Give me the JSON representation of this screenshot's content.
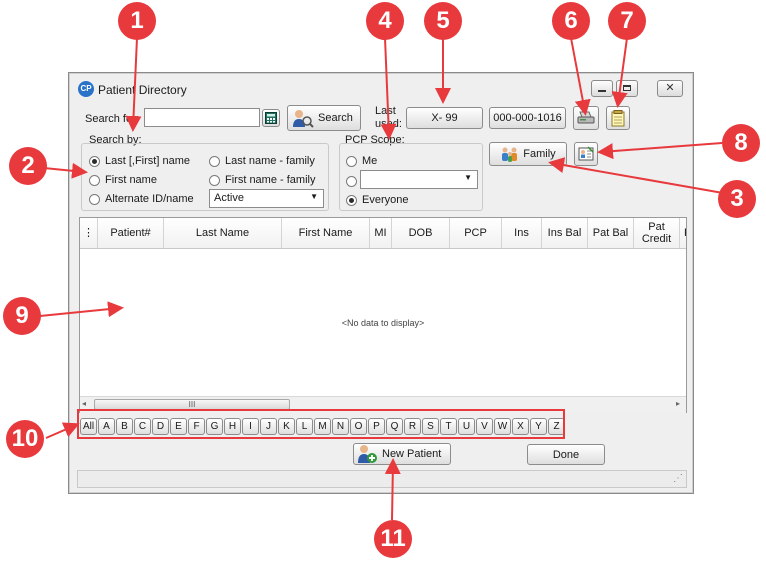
{
  "window": {
    "title": "Patient Directory",
    "app_icon": "CP"
  },
  "search": {
    "label": "Search for:",
    "value": "",
    "button_label": "Search",
    "last_used_label_1": "Last",
    "last_used_label_2": "used:",
    "last_used_1": "X- 99",
    "last_used_2": "000-000-1016"
  },
  "search_by": {
    "title": "Search by:",
    "options": [
      "Last [,First] name",
      "First name",
      "Alternate ID/name",
      "Last name - family",
      "First name - family"
    ],
    "selected": "Last [,First] name",
    "status_select": "Active"
  },
  "pcp_scope": {
    "title": "PCP Scope:",
    "options": [
      "Me",
      "",
      "Everyone"
    ],
    "selected": "Everyone",
    "select_value": ""
  },
  "family_button": "Family",
  "grid": {
    "columns": [
      "Patient#",
      "Last Name",
      "First Name",
      "MI",
      "DOB",
      "PCP",
      "Ins",
      "Ins Bal",
      "Pat Bal",
      "Pat Credit",
      "Pr"
    ],
    "empty_text": "<No data to display>",
    "scroll_thumb": "III"
  },
  "alphabet": [
    "All",
    "A",
    "B",
    "C",
    "D",
    "E",
    "F",
    "G",
    "H",
    "I",
    "J",
    "K",
    "L",
    "M",
    "N",
    "O",
    "P",
    "Q",
    "R",
    "S",
    "T",
    "U",
    "V",
    "W",
    "X",
    "Y",
    "Z"
  ],
  "buttons": {
    "new_patient": "New Patient",
    "done": "Done"
  },
  "callouts": [
    "1",
    "2",
    "3",
    "4",
    "5",
    "6",
    "7",
    "8",
    "9",
    "10",
    "11"
  ],
  "colors": {
    "callout": "#e8393d",
    "window_bg": "#efefef"
  }
}
